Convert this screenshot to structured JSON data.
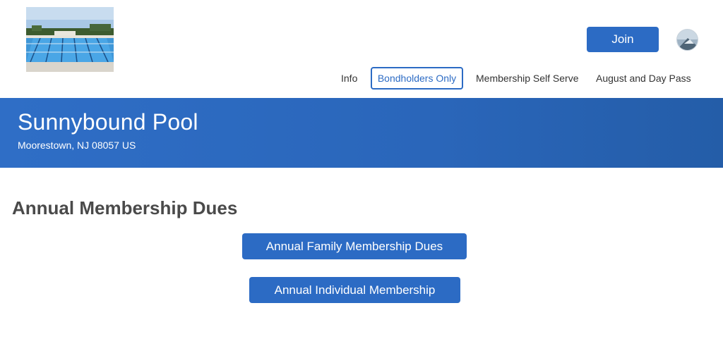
{
  "header": {
    "logo_icon": "pool-photo",
    "join_label": "Join",
    "avatar_icon": "user-avatar"
  },
  "nav": {
    "items": [
      {
        "label": "Info",
        "active": false
      },
      {
        "label": "Bondholders Only",
        "active": true
      },
      {
        "label": "Membership Self Serve",
        "active": false
      },
      {
        "label": "August and Day Pass",
        "active": false
      }
    ]
  },
  "banner": {
    "title": "Sunnybound Pool",
    "address": "Moorestown, NJ 08057 US"
  },
  "main": {
    "section_title": "Annual Membership Dues",
    "buttons": [
      {
        "label": "Annual Family Membership Dues"
      },
      {
        "label": "Annual Individual Membership"
      }
    ]
  },
  "colors": {
    "accent": "#2c6bc4",
    "banner": "#2a66ba",
    "heading": "#4a4a4a"
  }
}
